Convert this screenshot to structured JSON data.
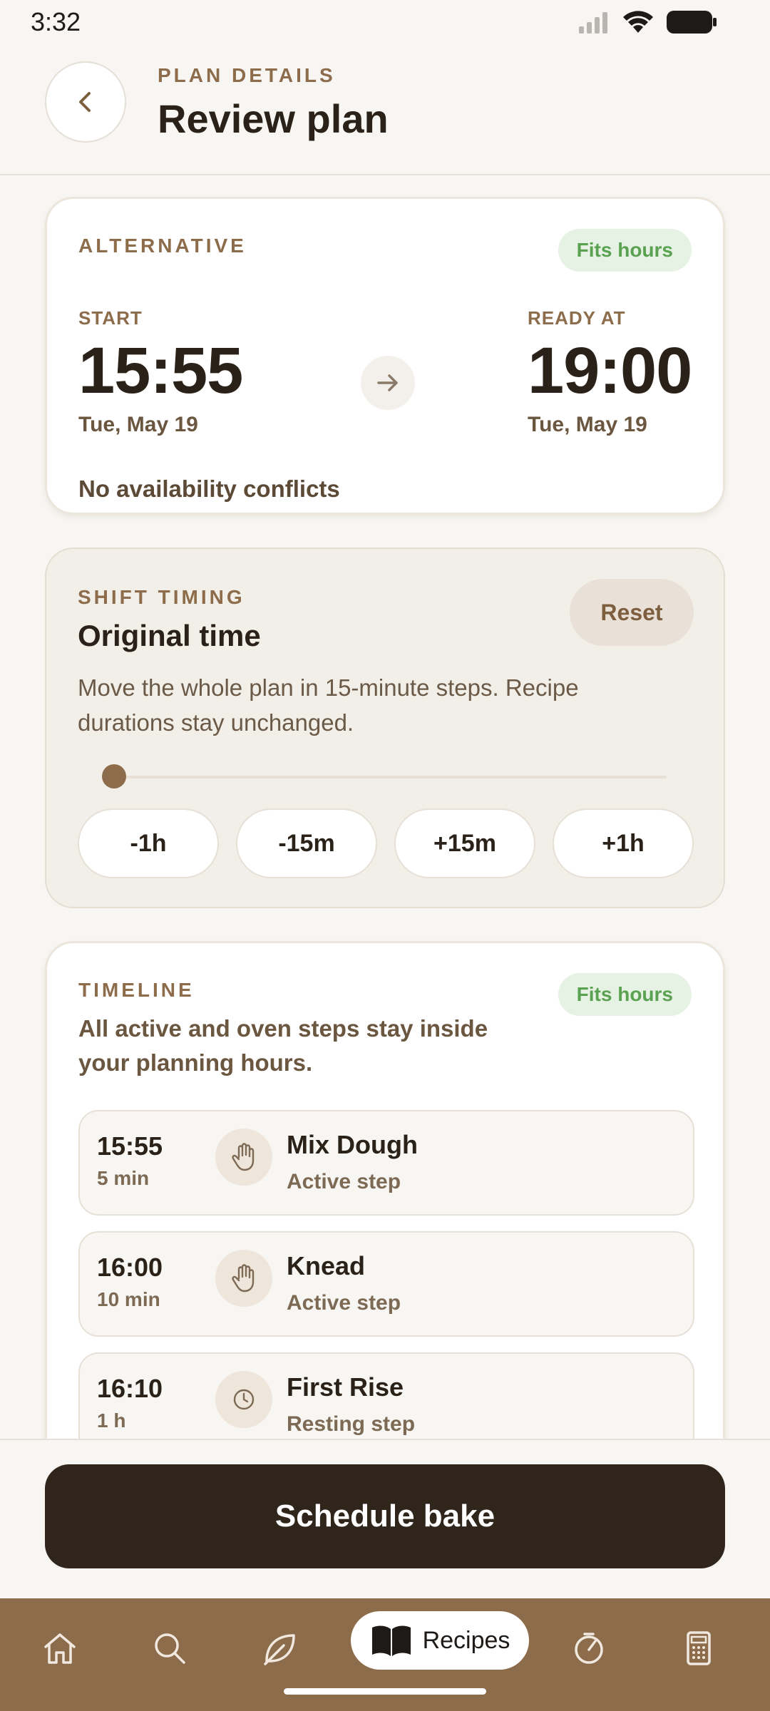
{
  "status_bar": {
    "time": "3:32"
  },
  "header": {
    "eyebrow": "PLAN DETAILS",
    "title": "Review plan"
  },
  "alternative": {
    "eyebrow": "ALTERNATIVE",
    "badge": "Fits hours",
    "start_label": "START",
    "start_time": "15:55",
    "start_date": "Tue, May 19",
    "ready_label": "READY AT",
    "ready_time": "19:00",
    "ready_date": "Tue, May 19",
    "conflicts": "No availability conflicts"
  },
  "shift": {
    "eyebrow": "SHIFT TIMING",
    "reset_label": "Reset",
    "title": "Original time",
    "description": "Move the whole plan in 15-minute steps. Recipe durations stay unchanged.",
    "slider_value": 0,
    "buttons": [
      "-1h",
      "-15m",
      "+15m",
      "+1h"
    ]
  },
  "timeline": {
    "eyebrow": "TIMELINE",
    "badge": "Fits hours",
    "description": "All active and oven steps stay inside your planning hours.",
    "steps": [
      {
        "time": "15:55",
        "duration": "5 min",
        "name": "Mix Dough",
        "kind": "Active step",
        "icon": "hand-icon"
      },
      {
        "time": "16:00",
        "duration": "10 min",
        "name": "Knead",
        "kind": "Active step",
        "icon": "hand-icon"
      },
      {
        "time": "16:10",
        "duration": "1 h",
        "name": "First Rise",
        "kind": "Resting step",
        "icon": "clock-icon"
      }
    ]
  },
  "action": {
    "schedule_label": "Schedule bake"
  },
  "nav": {
    "items": [
      "home-icon",
      "search-icon",
      "leaf-icon",
      "recipes-icon",
      "timer-icon",
      "calculator-icon"
    ],
    "active_label": "Recipes"
  },
  "colors": {
    "accent": "#8c6c4a",
    "success": "#5aa152",
    "dark": "#2f251b"
  }
}
